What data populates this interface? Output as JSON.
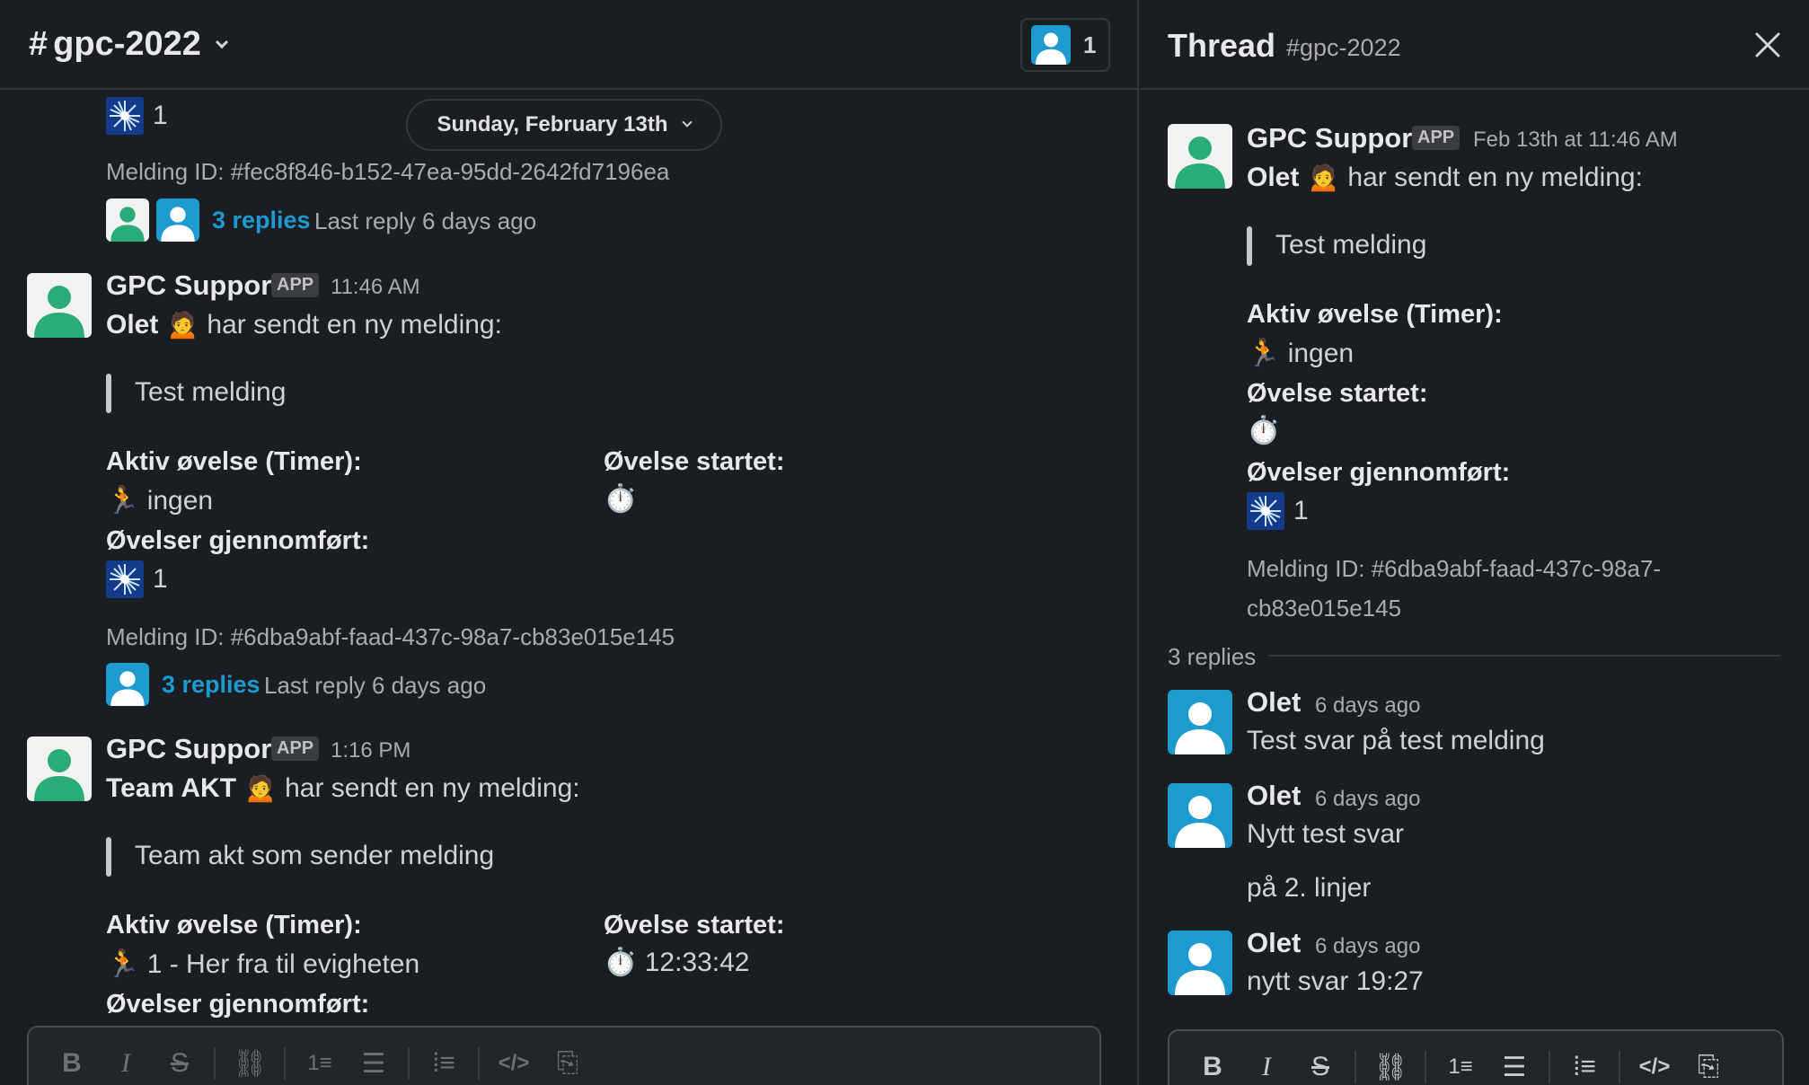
{
  "channel": {
    "name": "gpc-2022",
    "hash": "#",
    "member_count": "1"
  },
  "date_pill": "Sunday, February 13th",
  "top_partial": {
    "count": "1",
    "melding_id": "Melding ID: #fec8f846-b152-47ea-95dd-2642fd7196ea",
    "replies": "3 replies",
    "last_reply": "Last reply 6 days ago"
  },
  "msg1": {
    "sender": "GPC Support",
    "badge": "APP",
    "time": "11:46 AM",
    "line_user": "Olet",
    "line_rest": "har sendt en ny melding:",
    "quote": "Test melding",
    "aktiv_label": "Aktiv øvelse (Timer):",
    "aktiv_value": "ingen",
    "startet_label": "Øvelse startet:",
    "startet_value": "",
    "gjennomfort_label": "Øvelser gjennomført:",
    "gjennomfort_value": "1",
    "melding_id": "Melding ID: #6dba9abf-faad-437c-98a7-cb83e015e145",
    "replies": "3 replies",
    "last_reply": "Last reply 6 days ago"
  },
  "msg2": {
    "sender": "GPC Support",
    "badge": "APP",
    "time": "1:16 PM",
    "line_user": "Team AKT",
    "line_rest": "har sendt en ny melding:",
    "quote": "Team akt som sender melding",
    "aktiv_label": "Aktiv øvelse (Timer):",
    "aktiv_value": "1 - Her fra til evigheten",
    "startet_label": "Øvelse startet:",
    "startet_value": "12:33:42",
    "gjennomfort_label": "Øvelser gjennomført:"
  },
  "thread": {
    "title": "Thread",
    "channel": "#gpc-2022",
    "parent": {
      "sender": "GPC Support",
      "badge": "APP",
      "time": "Feb 13th at 11:46 AM",
      "line_user": "Olet",
      "line_rest": "har sendt en ny melding:",
      "quote": "Test melding",
      "aktiv_label": "Aktiv øvelse (Timer):",
      "aktiv_value": "ingen",
      "startet_label": "Øvelse startet:",
      "gjennomfort_label": "Øvelser gjennomført:",
      "gjennomfort_value": "1",
      "melding_id_1": "Melding ID: #6dba9abf-faad-437c-98a7-",
      "melding_id_2": "cb83e015e145"
    },
    "reply_count": "3 replies",
    "replies": [
      {
        "sender": "Olet",
        "time": "6 days ago",
        "text": "Test svar på test melding"
      },
      {
        "sender": "Olet",
        "time": "6 days ago",
        "text": "Nytt test svar",
        "text2": "på 2. linjer"
      },
      {
        "sender": "Olet",
        "time": "6 days ago",
        "text": "nytt svar 19:27"
      }
    ]
  },
  "icons": {
    "person_emoji": "🙍",
    "runner_emoji": "🏃",
    "stopwatch_emoji": "⏱️"
  },
  "colors": {
    "link": "#1d9bd1",
    "background": "#1a1d21",
    "avatar_green": "#2bac76",
    "avatar_blue": "#1d9bd1"
  }
}
